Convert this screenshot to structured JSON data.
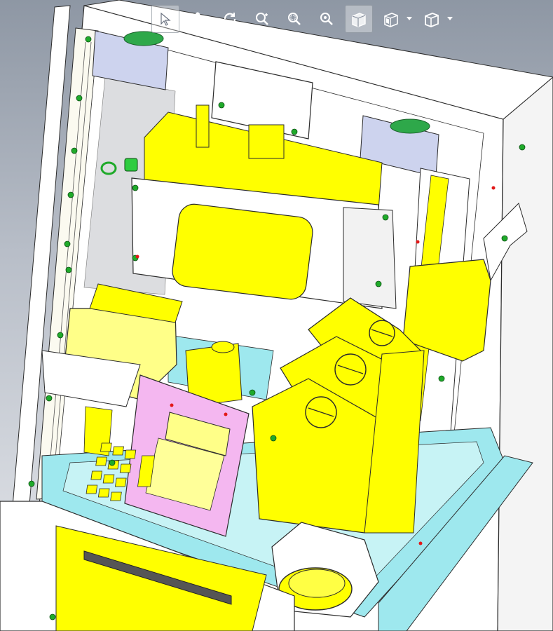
{
  "viewport": {
    "model": "vending-machine-cabinet-assembly",
    "colors": {
      "background_top": "#8e97a4",
      "background_bottom": "#e6e8ec",
      "yellow_parts": "#ffff00",
      "cyan_frame": "#9ee8ee",
      "pink_panel": "#f4b7f0",
      "lavender_plates": "#cdd3ee",
      "green_fasteners": "#1faa2a",
      "edge_lines": "#2b2b2b",
      "white_faces": "#ffffff"
    }
  },
  "hud_toolbar": {
    "buttons": [
      {
        "name": "select-icon",
        "active": true
      },
      {
        "name": "pan-icon",
        "active": false
      },
      {
        "name": "rotate-icon",
        "active": false
      },
      {
        "name": "zoom-to-fit-icon",
        "active": false
      },
      {
        "name": "zoom-to-area-icon",
        "active": false
      },
      {
        "name": "zoom-in-out-icon",
        "active": false
      },
      {
        "name": "view-orientation-icon",
        "active": true
      },
      {
        "name": "display-style-icon",
        "active": false,
        "dropdown": true
      },
      {
        "name": "view-cube-icon",
        "active": false,
        "dropdown": true
      }
    ]
  }
}
